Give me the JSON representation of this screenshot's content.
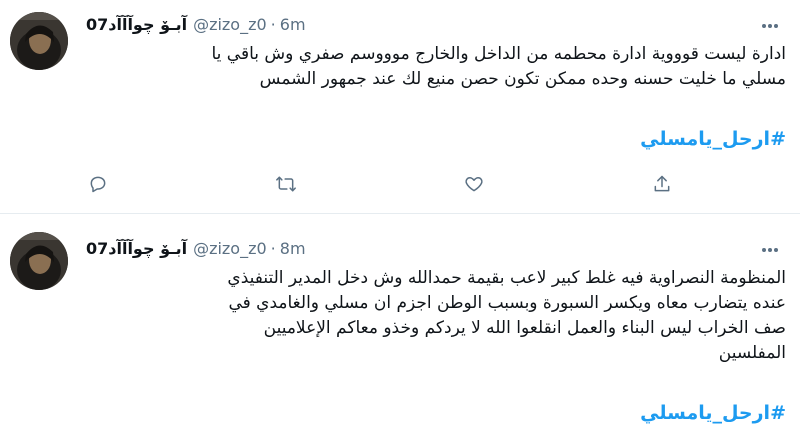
{
  "tweets": [
    {
      "display_name": "آبـۆ چوآآآد07",
      "handle": "@zizo_z0",
      "separator": "·",
      "time": "6m",
      "text_lines": [
        "ادارة ليست قوووية ادارة محطمه من الداخل والخارج موووسم صفري وش باقي يا",
        "مسلي ما خليت حسنه وحده ممكن تكون حصن منيع لك عند جمهور الشمس"
      ],
      "hashtag": "#ارحل_يامسلي",
      "actions": [
        "reply-icon",
        "retweet-icon",
        "like-icon",
        "share-icon"
      ]
    },
    {
      "display_name": "آبـۆ چوآآآد07",
      "handle": "@zizo_z0",
      "separator": "·",
      "time": "8m",
      "text_lines": [
        "المنظومة النصراوية فيه غلط كبير لاعب بقيمة حمدالله وش دخل المدير التنفيذي",
        "عنده يتضارب معاه ويكسر السبورة وبسبب الوطن اجزم ان مسلي والغامدي في",
        "صف الخراب ليس البناء والعمل انقلعوا الله لا يردكم وخذو معاكم الإعلاميين",
        "المفلسين"
      ],
      "hashtag": "#ارحل_يامسلي"
    }
  ]
}
